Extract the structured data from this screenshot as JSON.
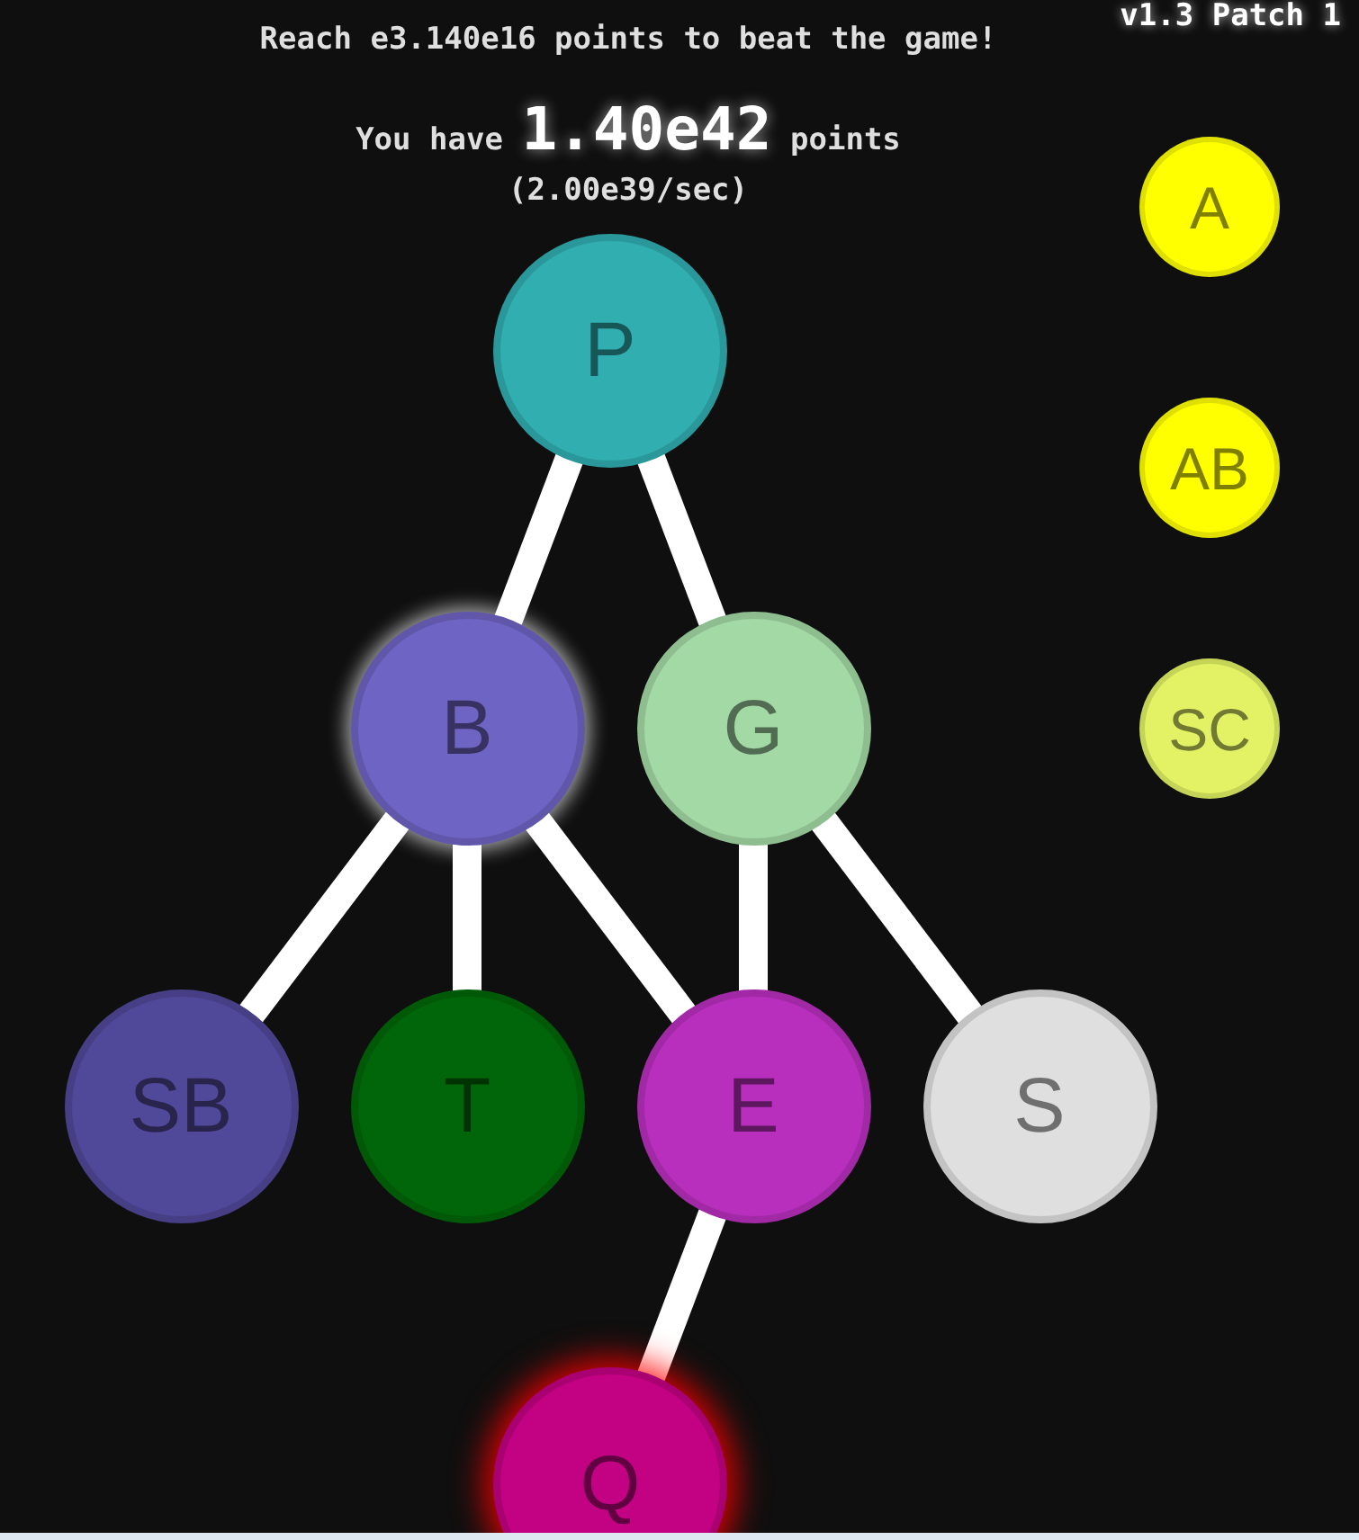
{
  "version": "v1.3 Patch 1",
  "header": {
    "goal": "Reach e3.140e16 points to beat the game!",
    "points": "You have **1.40e42** points",
    "rate": "(2.00e39/sec)"
  },
  "tree": {
    "rows": [
      {
        "nodes": [
          {
            "label": "P",
            "color": "#31aeb0",
            "can_reset": false,
            "notify": false,
            "branches": {
              "left": true,
              "down": false,
              "right": true
            }
          }
        ]
      },
      {
        "nodes": [
          {
            "label": "B",
            "color": "#6e64c4",
            "can_reset": true,
            "notify": false,
            "branches": {
              "left": true,
              "down": true,
              "right": true
            }
          },
          {
            "label": "G",
            "color": "#a3d9a5",
            "can_reset": false,
            "notify": false,
            "branches": {
              "left": false,
              "down": true,
              "right": true
            }
          }
        ]
      },
      {
        "nodes": [
          {
            "label": "SB",
            "color": "#504899",
            "can_reset": false,
            "notify": false,
            "branches": {
              "left": false,
              "down": false,
              "right": false
            }
          },
          {
            "label": "T",
            "color": "#006609",
            "can_reset": false,
            "notify": false,
            "branches": {
              "left": false,
              "down": false,
              "right": false
            }
          },
          {
            "label": "E",
            "color": "#b82fbd",
            "can_reset": false,
            "notify": false,
            "branches": {
              "left": true,
              "down": false,
              "right": false
            }
          },
          {
            "label": "S",
            "color": "#dfdfdf",
            "can_reset": false,
            "notify": false,
            "branches": {
              "left": false,
              "down": false,
              "right": false
            }
          }
        ]
      },
      {
        "nodes": [
          {
            "label": "Q",
            "color": "#c20282",
            "can_reset": false,
            "notify": true
          }
        ]
      }
    ]
  },
  "side_nodes": [
    {
      "label": "A",
      "color": "#ffff00"
    },
    {
      "label": "AB",
      "color": "#ffff00"
    },
    {
      "label": "SC",
      "color": "#e2f264"
    }
  ]
}
